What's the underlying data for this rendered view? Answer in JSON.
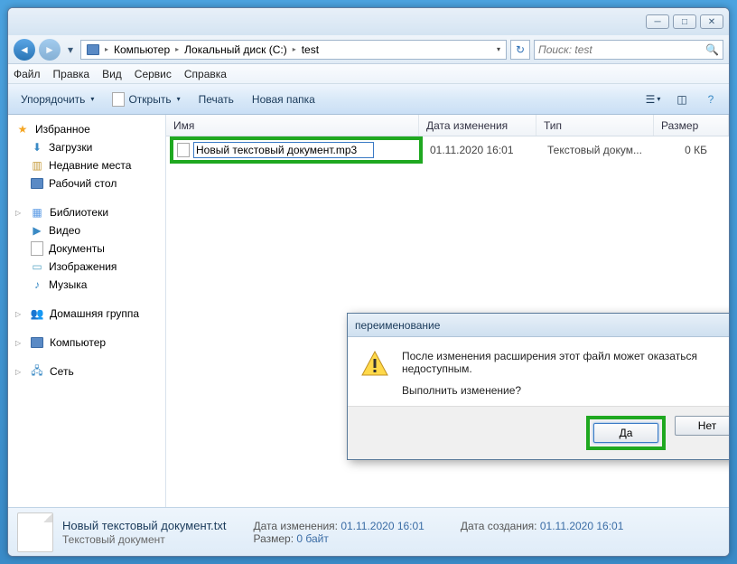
{
  "breadcrumb": {
    "items": [
      "Компьютер",
      "Локальный диск (C:)",
      "test"
    ]
  },
  "search": {
    "placeholder": "Поиск: test"
  },
  "menubar": [
    "Файл",
    "Правка",
    "Вид",
    "Сервис",
    "Справка"
  ],
  "toolbar": {
    "organize": "Упорядочить",
    "open": "Открыть",
    "print": "Печать",
    "newfolder": "Новая папка"
  },
  "sidebar": {
    "favorites": {
      "label": "Избранное",
      "items": [
        "Загрузки",
        "Недавние места",
        "Рабочий стол"
      ]
    },
    "libraries": {
      "label": "Библиотеки",
      "items": [
        "Видео",
        "Документы",
        "Изображения",
        "Музыка"
      ]
    },
    "homegroup": "Домашняя группа",
    "computer": "Компьютер",
    "network": "Сеть"
  },
  "columns": {
    "name": "Имя",
    "date": "Дата изменения",
    "type": "Тип",
    "size": "Размер"
  },
  "file": {
    "rename_value": "Новый текстовый документ.mp3",
    "date": "01.11.2020 16:01",
    "type": "Текстовый докум...",
    "size": "0 КБ"
  },
  "dialog": {
    "title": "переименование",
    "line1": "После изменения расширения этот файл может оказаться недоступным.",
    "line2": "Выполнить изменение?",
    "yes": "Да",
    "no": "Нет"
  },
  "details": {
    "filename": "Новый текстовый документ.txt",
    "filetype": "Текстовый документ",
    "date_mod_label": "Дата изменения:",
    "date_mod": "01.11.2020 16:01",
    "size_label": "Размер:",
    "size": "0 байт",
    "date_created_label": "Дата создания:",
    "date_created": "01.11.2020 16:01"
  }
}
